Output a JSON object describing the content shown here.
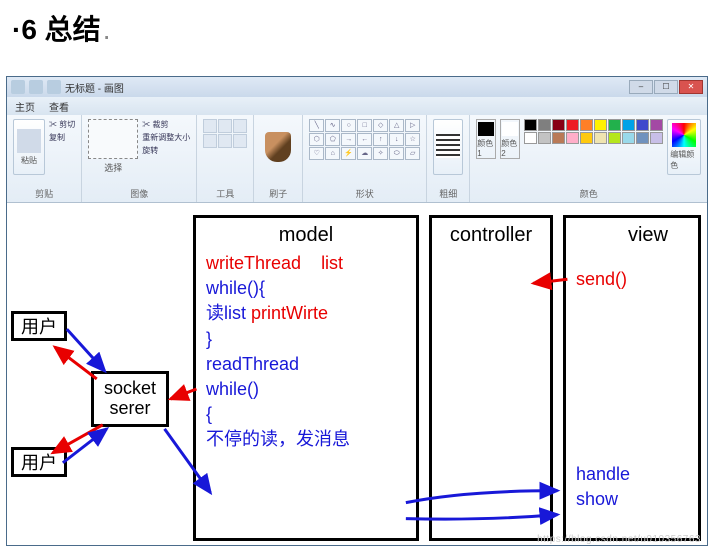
{
  "page": {
    "heading": "6 总结"
  },
  "window": {
    "title": "无标题 - 画图",
    "menu": {
      "tab1": "主页",
      "tab2": "查看"
    },
    "controls": {
      "min": "–",
      "max": "☐",
      "close": "✕"
    }
  },
  "ribbon": {
    "clipboard": {
      "label": "剪贴",
      "paste": "粘贴",
      "cut": "✂ 剪切",
      "copy": "复制"
    },
    "image": {
      "label": "图像",
      "select": "选择",
      "crop": "✂ 裁剪",
      "resize": "重新调整大小",
      "rotate": "旋转"
    },
    "tools": {
      "label": "工具"
    },
    "brush": {
      "label": "刷子"
    },
    "shapes": {
      "label": "形状"
    },
    "size": {
      "label": "粗细"
    },
    "colors": {
      "label": "颜色",
      "slot1": "颜色 1",
      "slot2": "颜色 2",
      "c1": "#000000",
      "c2": "#ffffff",
      "palette": [
        "#000000",
        "#7f7f7f",
        "#880015",
        "#ed1c24",
        "#ff7f27",
        "#fff200",
        "#22b14c",
        "#00a2e8",
        "#3f48cc",
        "#a349a4",
        "#ffffff",
        "#c3c3c3",
        "#b97a57",
        "#ffaec9",
        "#ffc90e",
        "#efe4b0",
        "#b5e61d",
        "#99d9ea",
        "#7092be",
        "#c8bfe7"
      ],
      "edit": "编辑颜色"
    }
  },
  "diagram": {
    "user1": "用户",
    "user2": "用户",
    "socket": {
      "l1": "socket",
      "l2": "serer"
    },
    "model": {
      "title": "model",
      "l1a": "writeThread",
      "l1b": "list",
      "l2": "while(){",
      "l3a": "读list",
      "l3b": "printWirte",
      "l4": "}",
      "l5": "readThread",
      "l6": "while()",
      "l7": "{",
      "l8": "不停的读，发消息"
    },
    "controller": {
      "title": "controller"
    },
    "view": {
      "title": "view",
      "l1": "send()",
      "l2": "handle",
      "l3": "show"
    }
  },
  "watermark": "https://blog.csdn.net/u010356763"
}
